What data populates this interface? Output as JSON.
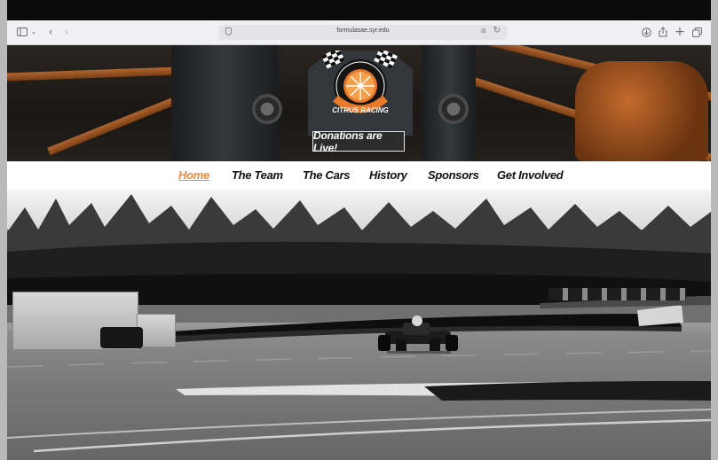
{
  "browser": {
    "url": "formulasae.syr.edu",
    "icons": [
      "sidebar-icon",
      "chevron-down-icon",
      "back-icon",
      "forward-icon",
      "shield-icon",
      "extension-icon",
      "reload-icon",
      "download-icon",
      "share-icon",
      "new-tab-icon",
      "tabs-icon"
    ]
  },
  "hero": {
    "logo_text": "CITRUS RACING",
    "donate_label": "Donations are Live!"
  },
  "nav": {
    "items": [
      {
        "label": "Home",
        "active": true
      },
      {
        "label": "The Team",
        "active": false
      },
      {
        "label": "The Cars",
        "active": false
      },
      {
        "label": "History",
        "active": false
      },
      {
        "label": "Sponsors",
        "active": false
      },
      {
        "label": "Get Involved",
        "active": false
      }
    ]
  },
  "colors": {
    "accent": "#f08a3a",
    "logo_orange": "#e8782a",
    "nav_text": "#111111"
  }
}
